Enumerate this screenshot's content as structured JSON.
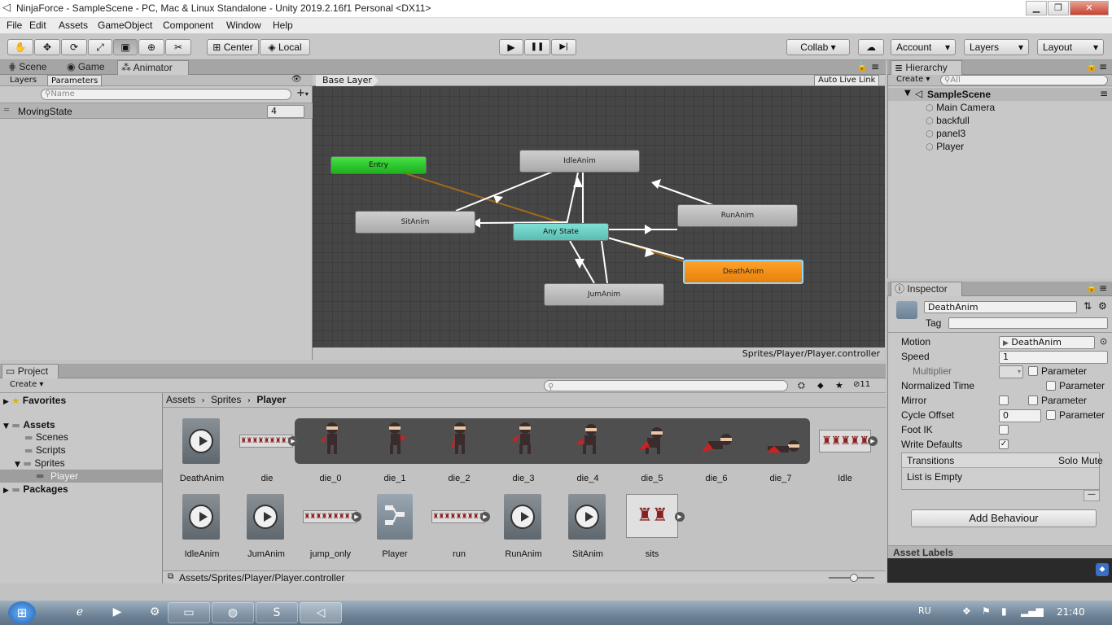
{
  "window": {
    "title": "NinjaForce - SampleScene - PC, Mac & Linux Standalone - Unity 2019.2.16f1 Personal <DX11>",
    "controls": [
      "▁",
      "❐",
      "✕"
    ]
  },
  "menu": [
    "File",
    "Edit",
    "Assets",
    "GameObject",
    "Component",
    "Window",
    "Help"
  ],
  "toolbar": {
    "tools": [
      "✋",
      "✥",
      "⟳",
      "⤢",
      "▣",
      "⊕",
      "✂"
    ],
    "pivot": "Center",
    "space": "Local",
    "play": "▶",
    "pause": "❚❚",
    "step": "▶|",
    "collab": "Collab ▾",
    "cloud": "☁",
    "account": "Account",
    "layers": "Layers",
    "layout": "Layout"
  },
  "left_tabs": [
    "Scene",
    "Game",
    "Animator"
  ],
  "animator": {
    "subtabs": [
      "Layers",
      "Parameters"
    ],
    "search_placeholder": "Name",
    "parameter": {
      "name": "MovingState",
      "value": "4"
    },
    "breadcrumb": "Base Layer",
    "auto_live_link": "Auto Live Link",
    "footer_path": "Sprites/Player/Player.controller",
    "nodes": {
      "entry": "Entry",
      "idle": "IdleAnim",
      "sit": "SitAnim",
      "any": "Any State",
      "run": "RunAnim",
      "death": "DeathAnim",
      "jump": "JumAnim"
    }
  },
  "hierarchy": {
    "tab": "Hierarchy",
    "create": "Create",
    "search_placeholder": "All",
    "scene": "SampleScene",
    "items": [
      "Main Camera",
      "backfull",
      "panel3",
      "Player"
    ]
  },
  "inspector": {
    "tab": "Inspector",
    "name": "DeathAnim",
    "tag_label": "Tag",
    "motion_label": "Motion",
    "motion_value": "DeathAnim",
    "speed_label": "Speed",
    "speed_value": "1",
    "parameter_label": "Parameter",
    "multiplier_label": "Multiplier",
    "normalized_time_label": "Normalized Time",
    "mirror_label": "Mirror",
    "cycle_offset_label": "Cycle Offset",
    "cycle_offset_value": "0",
    "foot_ik_label": "Foot IK",
    "write_defaults_label": "Write Defaults",
    "transitions_label": "Transitions",
    "solo_label": "Solo",
    "mute_label": "Mute",
    "list_empty": "List is Empty",
    "add_behaviour": "Add Behaviour",
    "asset_labels": "Asset Labels"
  },
  "project": {
    "tab": "Project",
    "create": "Create",
    "filter_count": "11",
    "tree": {
      "favorites": "Favorites",
      "assets": "Assets",
      "scenes": "Scenes",
      "scripts": "Scripts",
      "sprites": "Sprites",
      "player": "Player",
      "packages": "Packages"
    },
    "breadcrumb": [
      "Assets",
      "Sprites",
      "Player"
    ],
    "row1": [
      "DeathAnim",
      "die",
      "die_0",
      "die_1",
      "die_2",
      "die_3",
      "die_4",
      "die_5",
      "die_6",
      "die_7",
      "Idle"
    ],
    "row2": [
      "IdleAnim",
      "JumAnim",
      "jump_only",
      "Player",
      "run",
      "RunAnim",
      "SitAnim",
      "sits"
    ],
    "footer_path": "Assets/Sprites/Player/Player.controller"
  },
  "taskbar": {
    "lang": "RU",
    "time": "21:40"
  }
}
